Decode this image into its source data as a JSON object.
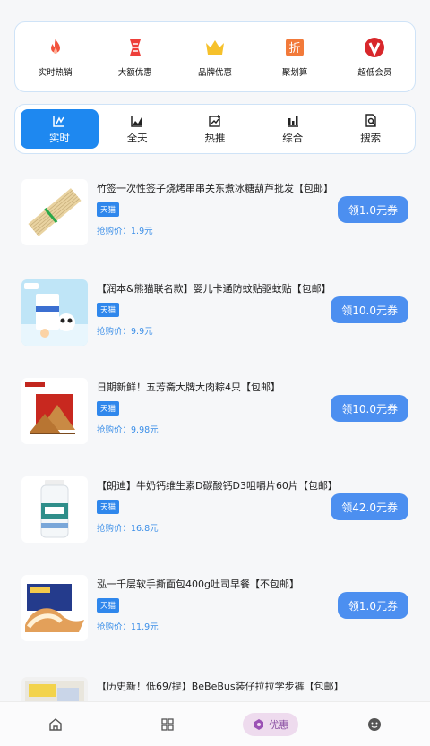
{
  "quick_menu": [
    {
      "label": "实时热销",
      "icon": "flame-icon"
    },
    {
      "label": "大额优惠",
      "icon": "coupon-icon"
    },
    {
      "label": "品牌优惠",
      "icon": "crown-icon"
    },
    {
      "label": "聚划算",
      "icon": "discount-icon"
    },
    {
      "label": "超低会员",
      "icon": "v-badge-icon"
    }
  ],
  "tabs": [
    {
      "label": "实时",
      "icon": "realtime-chart-icon",
      "active": true
    },
    {
      "label": "全天",
      "icon": "area-chart-icon"
    },
    {
      "label": "热推",
      "icon": "trending-icon"
    },
    {
      "label": "综合",
      "icon": "bar-chart-icon"
    },
    {
      "label": "搜索",
      "icon": "search-doc-icon"
    }
  ],
  "products": [
    {
      "title": "竹签一次性签子烧烤串串关东煮冰糖葫芦批发【包邮】",
      "tag": "天猫",
      "price_label": "抢购价：",
      "price": "1.9元",
      "coupon": "领1.0元券"
    },
    {
      "title": "【润本&熊猫联名款】婴儿卡通防蚊贴驱蚊贴【包邮】",
      "tag": "天猫",
      "price_label": "抢购价：",
      "price": "9.9元",
      "coupon": "领10.0元券"
    },
    {
      "title": "日期新鲜！五芳斋大牌大肉粽4只【包邮】",
      "tag": "天猫",
      "price_label": "抢购价：",
      "price": "9.98元",
      "coupon": "领10.0元券"
    },
    {
      "title": "【朗迪】牛奶钙维生素D碳酸钙D3咀嚼片60片【包邮】",
      "tag": "天猫",
      "price_label": "抢购价：",
      "price": "16.8元",
      "coupon": "领42.0元券"
    },
    {
      "title": "泓一千层软手撕面包400g吐司早餐【不包邮】",
      "tag": "天猫",
      "price_label": "抢购价：",
      "price": "11.9元",
      "coupon": "领1.0元券"
    },
    {
      "title": "【历史新！低69/提】BeBeBus装仔拉拉学步裤【包邮】"
    }
  ],
  "bottom_nav": [
    {
      "icon": "home-icon"
    },
    {
      "icon": "grid-icon"
    },
    {
      "icon": "discount-tag-icon",
      "label": "优惠",
      "active": true
    },
    {
      "icon": "smiley-icon"
    }
  ],
  "colors": {
    "accent": "#1e88f0",
    "coupon": "#4c8ff0",
    "price": "#3a8ee8",
    "nav_active_bg": "#eedbee"
  }
}
